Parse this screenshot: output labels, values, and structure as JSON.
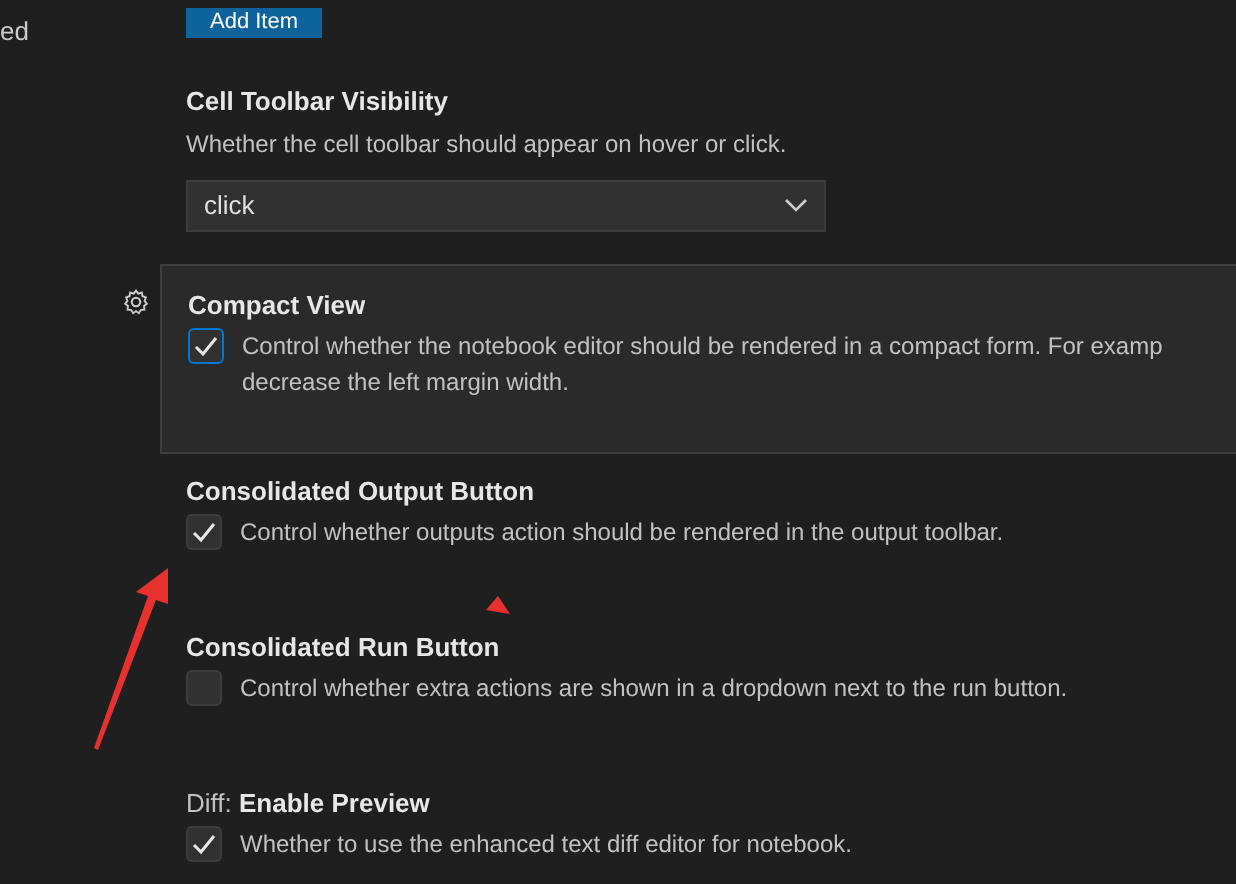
{
  "sidebar": {
    "items": [
      {
        "label": "ed"
      }
    ]
  },
  "settings": [
    {
      "kind": "button",
      "label": "Add Item"
    },
    {
      "kind": "dropdown",
      "title": "Cell Toolbar Visibility",
      "description": "Whether the cell toolbar should appear on hover or click.",
      "value": "click"
    },
    {
      "kind": "checkbox",
      "title": "Compact View",
      "description": "Control whether the notebook editor should be rendered in a compact form. For examp decrease the left margin width.",
      "checked": true,
      "focused": true
    },
    {
      "kind": "checkbox",
      "title": "Consolidated Output Button",
      "description": "Control whether outputs action should be rendered in the output toolbar.",
      "checked": true,
      "focused": false
    },
    {
      "kind": "checkbox",
      "title": "Consolidated Run Button",
      "description": "Control whether extra actions are shown in a dropdown next to the run button.",
      "checked": false,
      "focused": false
    },
    {
      "kind": "checkbox",
      "category": "Diff:",
      "title": "Enable Preview",
      "description": "Whether to use the enhanced text diff editor for notebook.",
      "checked": true,
      "focused": false
    }
  ]
}
